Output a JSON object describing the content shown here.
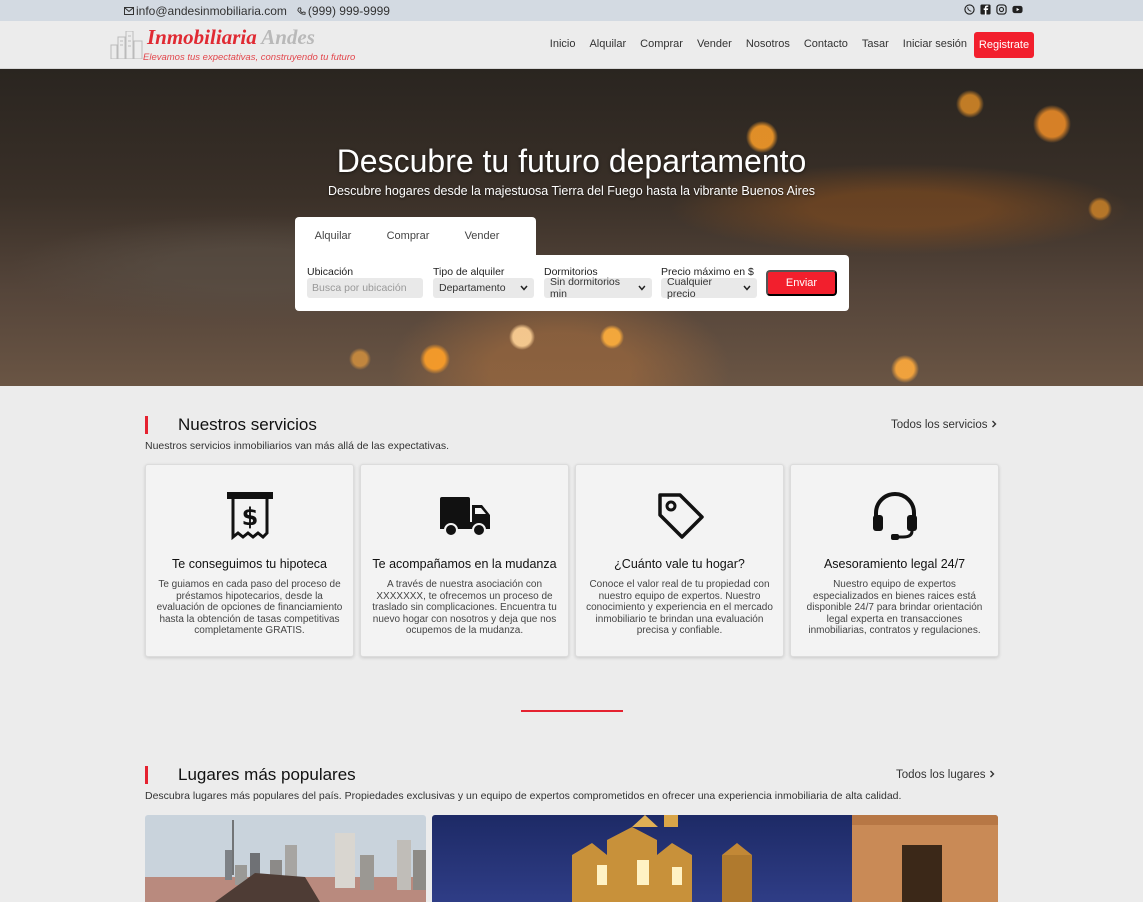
{
  "topbar": {
    "email": "info@andesinmobiliaria.com",
    "phone": "(999) 999-9999",
    "social": [
      "whatsapp-icon",
      "facebook-icon",
      "instagram-icon",
      "youtube-icon"
    ]
  },
  "brand": {
    "name_part1": "Inmobiliaria",
    "name_part2": "Andes",
    "tagline": "Elevamos tus expectativas, construyendo tu futuro",
    "accent": "#f21f2d"
  },
  "nav": {
    "items": [
      "Inicio",
      "Alquilar",
      "Comprar",
      "Vender",
      "Nosotros",
      "Contacto",
      "Tasar",
      "Iniciar sesión"
    ],
    "register": "Registrate"
  },
  "hero": {
    "title": "Descubre tu futuro departamento",
    "subtitle": "Descubre hogares desde la majestuosa Tierra del Fuego hasta la vibrante Buenos Aires",
    "tabs": [
      "Alquilar",
      "Comprar",
      "Vender"
    ],
    "search": {
      "location_label": "Ubicación",
      "location_placeholder": "Busca por ubicación",
      "type_label": "Tipo de alquiler",
      "type_value": "Departamento",
      "rooms_label": "Dormitorios",
      "rooms_value": "Sin dormitorios min",
      "price_label": "Precio máximo en $",
      "price_value": "Cualquier precio",
      "submit": "Enviar"
    }
  },
  "services": {
    "title": "Nuestros servicios",
    "description": "Nuestros servicios inmobiliarios van más allá de las expectativas.",
    "link": "Todos los servicios",
    "cards": [
      {
        "icon": "receipt-dollar-icon",
        "title": "Te conseguimos tu hipoteca",
        "text": "Te guiamos en cada paso del proceso de préstamos hipotecarios, desde la evaluación de opciones de financiamiento hasta la obtención de tasas competitivas completamente GRATIS."
      },
      {
        "icon": "truck-icon",
        "title": "Te acompañamos en la mudanza",
        "text": "A través de nuestra asociación con XXXXXXX, te ofrecemos un proceso de traslado sin complicaciones. Encuentra tu nuevo hogar con nosotros y deja que nos ocupemos de la mudanza."
      },
      {
        "icon": "price-tag-icon",
        "title": "¿Cuánto vale tu hogar?",
        "text": "Conoce el valor real de tu propiedad con nuestro equipo de expertos. Nuestro conocimiento y experiencia en el mercado inmobiliario te brindan una evaluación precisa y confiable."
      },
      {
        "icon": "headset-icon",
        "title": "Asesoramiento legal 24/7",
        "text": "Nuestro equipo de expertos especializados en bienes raices está disponible 24/7 para brindar orientación legal experta en transacciones inmobiliarias, contratos y regulaciones."
      }
    ]
  },
  "places": {
    "title": "Lugares más populares",
    "description": "Descubra lugares más populares del país. Propiedades exclusivas y un equipo de expertos comprometidos en ofrecer una experiencia inmobiliaria de alta calidad.",
    "link": "Todos los lugares"
  }
}
